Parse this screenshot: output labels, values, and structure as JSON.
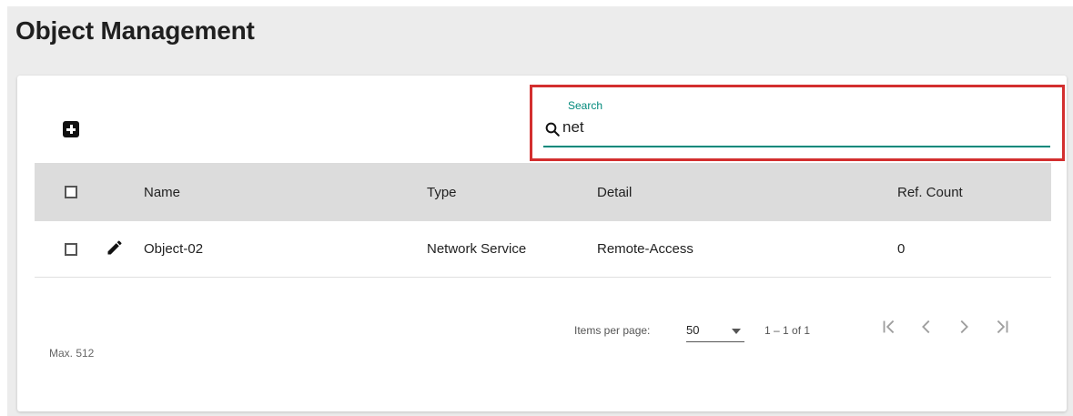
{
  "page": {
    "title": "Object Management"
  },
  "toolbar": {
    "add_icon": "add-box-icon"
  },
  "search": {
    "label": "Search",
    "value": "net",
    "icon": "search-icon"
  },
  "table": {
    "columns": [
      "Name",
      "Type",
      "Detail",
      "Ref. Count"
    ],
    "rows": [
      {
        "name": "Object-02",
        "type": "Network Service",
        "detail": "Remote-Access",
        "ref_count": "0"
      }
    ]
  },
  "paginator": {
    "items_per_page_label": "Items per page:",
    "page_size": "50",
    "range": "1 – 1 of 1"
  },
  "footer": {
    "max_label": "Max. 512"
  },
  "colors": {
    "accent": "#00897b",
    "highlight": "#d32f2f",
    "header_bg": "#dcdcdc",
    "page_bg": "#ececec"
  }
}
